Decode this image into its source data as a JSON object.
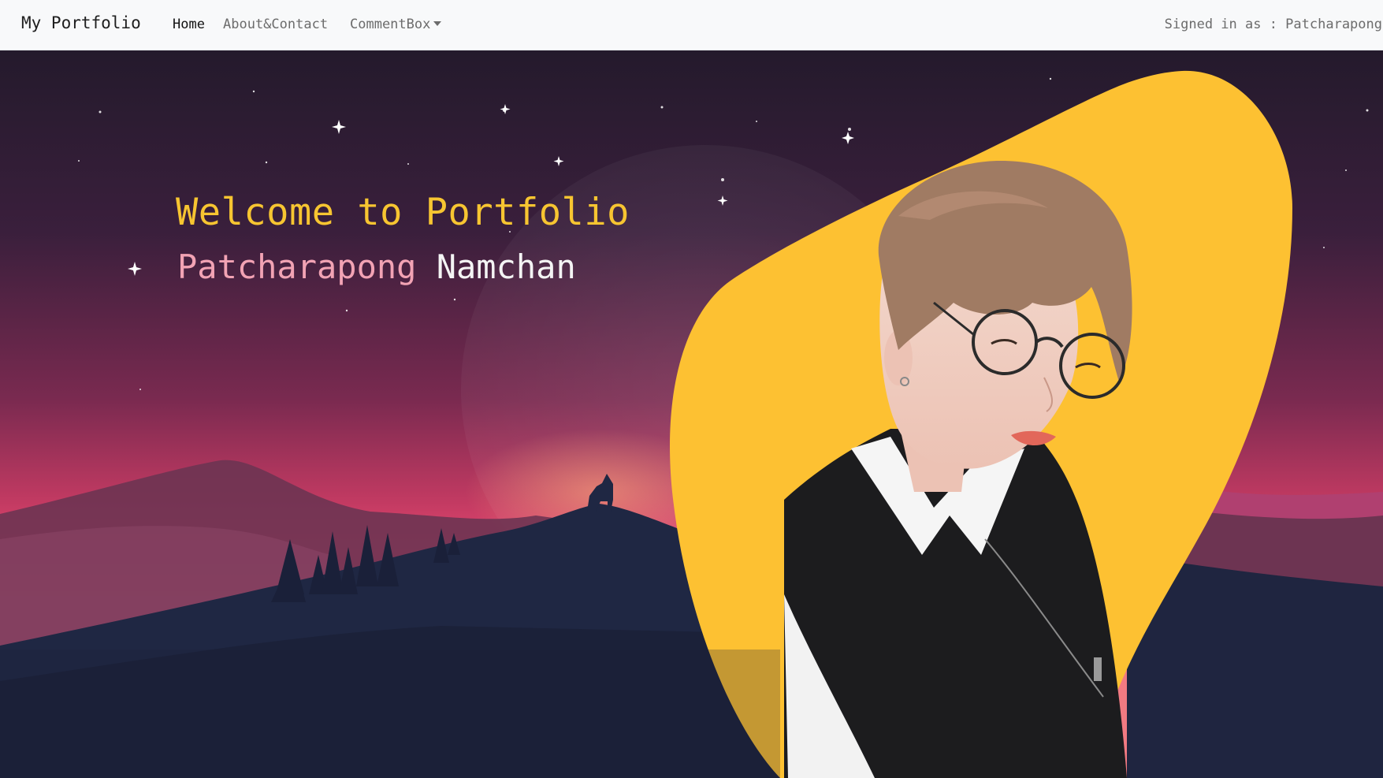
{
  "navbar": {
    "brand": "My Portfolio",
    "links": [
      {
        "label": "Home",
        "active": true
      },
      {
        "label": "About&Contact",
        "active": false
      },
      {
        "label": "CommentBox",
        "active": false,
        "dropdown": true
      }
    ],
    "signed_in_prefix": "Signed in as : ",
    "signed_in_user": "Patcharapong"
  },
  "hero": {
    "title": "Welcome to Portfolio",
    "name_first": "Patcharapong",
    "name_last": "Namchan"
  },
  "colors": {
    "accent": "#f7c531",
    "blob": "#fdc132",
    "name_first": "#f2a3b4",
    "sky_top": "#2a1a2f",
    "sky_glow": "#e6466e",
    "ground": "#1a2138"
  }
}
